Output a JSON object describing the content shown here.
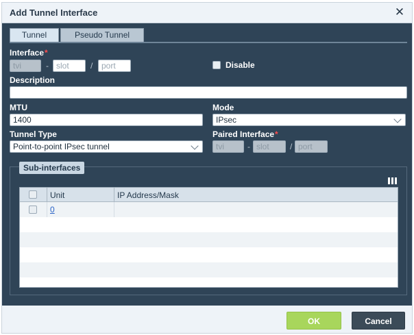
{
  "dialog": {
    "title": "Add Tunnel Interface",
    "close_glyph": "✕"
  },
  "tabs": [
    {
      "label": "Tunnel",
      "active": true
    },
    {
      "label": "Pseudo Tunnel",
      "active": false
    }
  ],
  "interface": {
    "label": "Interface",
    "required_mark": "*",
    "type_placeholder": "tvi",
    "slot_placeholder": "slot",
    "port_placeholder": "port",
    "sep1": "-",
    "sep2": "/",
    "disable_label": "Disable",
    "disable_checked": false
  },
  "description": {
    "label": "Description",
    "value": ""
  },
  "mtu": {
    "label": "MTU",
    "value": "1400"
  },
  "mode": {
    "label": "Mode",
    "value": "IPsec"
  },
  "tunnel_type": {
    "label": "Tunnel Type",
    "value": "Point-to-point IPsec tunnel"
  },
  "paired_interface": {
    "label": "Paired Interface",
    "required_mark": "*",
    "type_placeholder": "tvi",
    "slot_placeholder": "slot",
    "port_placeholder": "port",
    "sep1": "-",
    "sep2": "/"
  },
  "subinterfaces": {
    "legend": "Sub-interfaces",
    "columns": [
      "Unit",
      "IP Address/Mask"
    ],
    "rows": [
      {
        "unit": "0",
        "ip": ""
      }
    ]
  },
  "footer": {
    "ok_label": "OK",
    "cancel_label": "Cancel"
  },
  "colors": {
    "ok": "#a8d65c",
    "cancel": "#3b4b58",
    "panel": "#2f4457"
  }
}
